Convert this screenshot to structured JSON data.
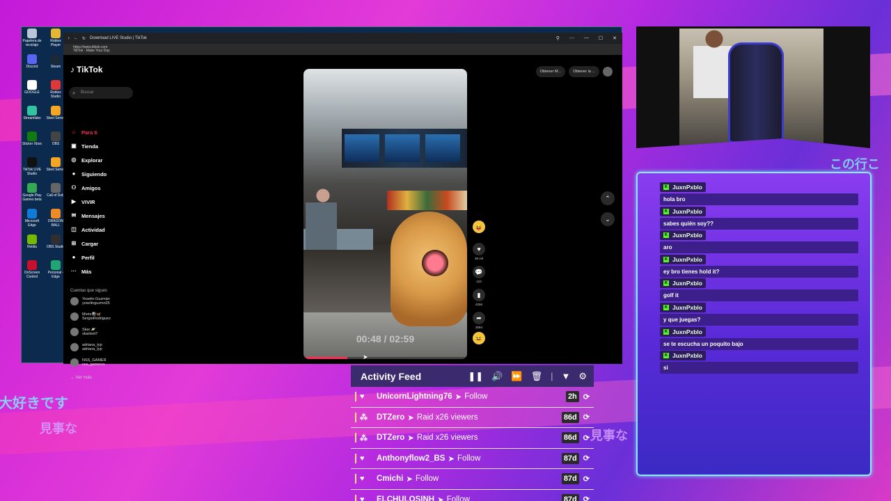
{
  "browser": {
    "tab_title": "Download LIVE Studio | TikTok",
    "url": "https://www.tiktok.com",
    "page_title": "TikTok - Make Your Day"
  },
  "desktop": {
    "icons": [
      {
        "label": "Papelera de reciclaje",
        "color": "#b9c6d6"
      },
      {
        "label": "Roblox Player",
        "color": "#e6b730"
      },
      {
        "label": "Discord",
        "color": "#5865f2"
      },
      {
        "label": "Steam",
        "color": "#1b2838"
      },
      {
        "label": "GOOGLE",
        "color": "#ffffff"
      },
      {
        "label": "Roblox Studio",
        "color": "#e03838"
      },
      {
        "label": "Streamlabs",
        "color": "#31c3a2"
      },
      {
        "label": "Steel Series",
        "color": "#f5a623"
      },
      {
        "label": "Sticker Xbox",
        "color": "#107c10"
      },
      {
        "label": "OBS",
        "color": "#444444"
      },
      {
        "label": "TikTok LIVE Studio",
        "color": "#111111"
      },
      {
        "label": "Steel Series",
        "color": "#f5a623"
      },
      {
        "label": "Google Play Games beta",
        "color": "#34a853"
      },
      {
        "label": "Call of Duty",
        "color": "#666666"
      },
      {
        "label": "Microsoft Edge",
        "color": "#0f7bd6"
      },
      {
        "label": "DRAGON BALL",
        "color": "#f08a24"
      },
      {
        "label": "Nvidia",
        "color": "#76b900"
      },
      {
        "label": "OBS Studio",
        "color": "#302e31"
      },
      {
        "label": "OnScreen Control",
        "color": "#c8102e"
      },
      {
        "label": "Personal - Edge",
        "color": "#1fa672"
      }
    ]
  },
  "tiktok": {
    "logo": "TikTok",
    "search_placeholder": "Buscar",
    "nav": [
      {
        "label": "Para ti",
        "icon": "home-icon",
        "glyph": "⌂",
        "active": true
      },
      {
        "label": "Tienda",
        "icon": "shop-icon",
        "glyph": "▣",
        "active": false
      },
      {
        "label": "Explorar",
        "icon": "compass-icon",
        "glyph": "◎",
        "active": false
      },
      {
        "label": "Siguiendo",
        "icon": "following-icon",
        "glyph": "●",
        "active": false
      },
      {
        "label": "Amigos",
        "icon": "friends-icon",
        "glyph": "⚇",
        "active": false
      },
      {
        "label": "VIVIR",
        "icon": "live-icon",
        "glyph": "▶",
        "active": false
      },
      {
        "label": "Mensajes",
        "icon": "messages-icon",
        "glyph": "✉",
        "active": false
      },
      {
        "label": "Actividad",
        "icon": "activity-icon",
        "glyph": "◫",
        "active": false
      },
      {
        "label": "Cargar",
        "icon": "upload-icon",
        "glyph": "⊞",
        "active": false
      },
      {
        "label": "Perfil",
        "icon": "profile-icon",
        "glyph": "●",
        "active": false
      },
      {
        "label": "Más",
        "icon": "more-icon",
        "glyph": "···",
        "active": false
      }
    ],
    "following_header": "Cuentas que sigues",
    "following": [
      {
        "name": "Yoselin Guzmán",
        "handle": "yoselinguzmn25"
      },
      {
        "name": "Mvrio🎱🦋",
        "handle": "SergioRodriguez"
      },
      {
        "name": "Skar 🪐",
        "handle": "skarleet7"
      },
      {
        "name": "adriana_typ",
        "handle": "adriana_typ"
      },
      {
        "name": "NSS_GAMER",
        "handle": "nss_gamerxx"
      }
    ],
    "see_more": "Ver más",
    "top_buttons": [
      "Obtener M...",
      "Obtener la ..."
    ],
    "video": {
      "time": "00:48 / 02:59",
      "progress": 0.27,
      "likes": "38 mil",
      "comments": "123",
      "saves": "4256",
      "shares": "2694"
    }
  },
  "chat": {
    "messages": [
      {
        "user": "JuxnPxblo",
        "text": "hola bro"
      },
      {
        "user": "JuxnPxblo",
        "text": "sabes quién soy??"
      },
      {
        "user": "JuxnPxblo",
        "text": "aro"
      },
      {
        "user": "JuxnPxblo",
        "text": "ey bro tienes hold it?"
      },
      {
        "user": "JuxnPxblo",
        "text": "golf it"
      },
      {
        "user": "JuxnPxblo",
        "text": "y que juegas?"
      },
      {
        "user": "JuxnPxblo",
        "text": "se te escucha un poquito bajo"
      },
      {
        "user": "JuxnPxblo",
        "text": "si"
      }
    ]
  },
  "activity_feed": {
    "title": "Activity Feed",
    "items": [
      {
        "user": "UnicornLightning76",
        "event": "Follow",
        "time": "2h",
        "icon": "heart-icon"
      },
      {
        "user": "DTZero",
        "event": "Raid x26 viewers",
        "time": "86d",
        "icon": "raid-icon"
      },
      {
        "user": "DTZero",
        "event": "Raid x26 viewers",
        "time": "86d",
        "icon": "raid-icon"
      },
      {
        "user": "Anthonyflow2_BS",
        "event": "Follow",
        "time": "87d",
        "icon": "heart-icon"
      },
      {
        "user": "Cmichi",
        "event": "Follow",
        "time": "87d",
        "icon": "heart-icon"
      },
      {
        "user": "ELCHULOSINH",
        "event": "Follow",
        "time": "87d",
        "icon": "heart-icon"
      }
    ]
  },
  "overlay_text": [
    "大好きです",
    "見事な",
    "見事な",
    "この行こ"
  ]
}
